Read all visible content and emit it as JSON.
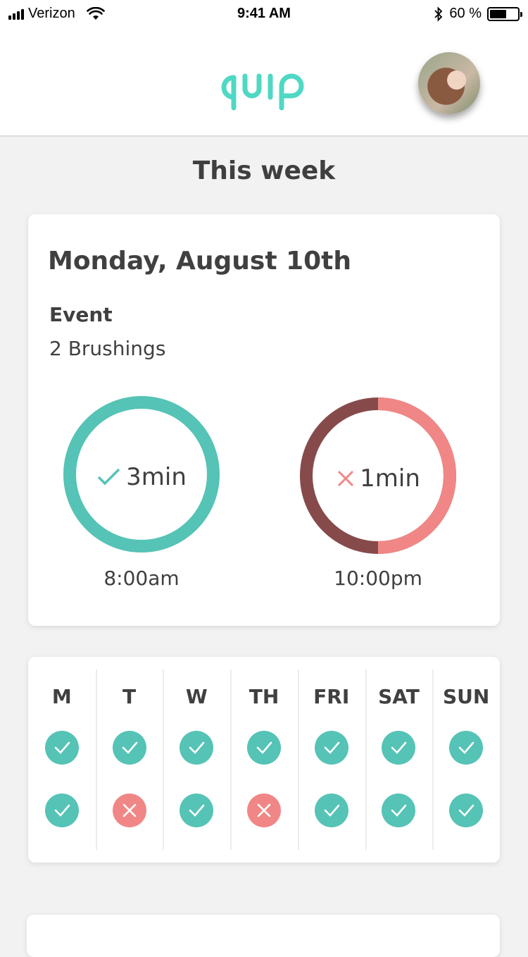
{
  "status_bar": {
    "carrier": "Verizon",
    "time": "9:41 AM",
    "battery_percent": "60 %",
    "battery_level": 0.6
  },
  "header": {
    "logo_text": "quip",
    "brand_color": "#4fd8c4",
    "avatar": "user-avatar"
  },
  "section_title": "This week",
  "day_card": {
    "title": "Monday, August 10th",
    "event_label": "Event",
    "event_value": "2 Brushings",
    "brushings": [
      {
        "duration": "3min",
        "time": "8:00am",
        "status": "complete",
        "progress": 1.0,
        "icon": "check-icon",
        "ring_color": "#55c3b5"
      },
      {
        "duration": "1min",
        "time": "10:00pm",
        "status": "incomplete",
        "progress": 0.5,
        "icon": "x-icon",
        "ring_color": "#f08786",
        "ring_track_color": "#874a4a"
      }
    ]
  },
  "week": {
    "days": [
      {
        "label": "M",
        "morning": "ok",
        "evening": "ok"
      },
      {
        "label": "T",
        "morning": "ok",
        "evening": "bad"
      },
      {
        "label": "W",
        "morning": "ok",
        "evening": "ok"
      },
      {
        "label": "TH",
        "morning": "ok",
        "evening": "bad"
      },
      {
        "label": "FRI",
        "morning": "ok",
        "evening": "ok"
      },
      {
        "label": "SAT",
        "morning": "ok",
        "evening": "ok"
      },
      {
        "label": "SUN",
        "morning": "ok",
        "evening": "ok"
      }
    ],
    "colors": {
      "ok": "#55c3b5",
      "bad": "#f08786"
    }
  }
}
